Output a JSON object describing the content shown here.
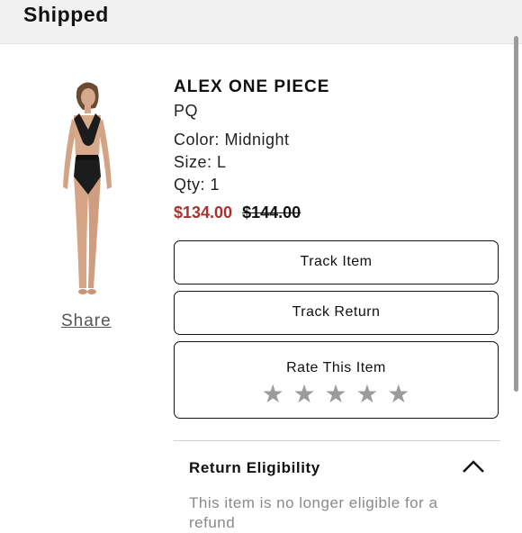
{
  "header": {
    "title": "Shipped"
  },
  "product": {
    "name": "ALEX ONE PIECE",
    "brand": "PQ",
    "color": "Color: Midnight",
    "size": "Size: L",
    "qty": "Qty: 1",
    "sale_price": "$134.00",
    "original_price": "$144.00",
    "share_label": "Share"
  },
  "actions": {
    "track_item": "Track Item",
    "track_return": "Track Return",
    "rate_label": "Rate This Item",
    "stars": [
      "★",
      "★",
      "★",
      "★",
      "★"
    ],
    "rating": 0
  },
  "eligibility": {
    "title": "Return Eligibility",
    "text": "This item is no longer eligible for a refund"
  },
  "colors": {
    "sale_price": "#a8322c",
    "stars": "#9b9b9b",
    "header_bg": "#f1f1f1"
  }
}
